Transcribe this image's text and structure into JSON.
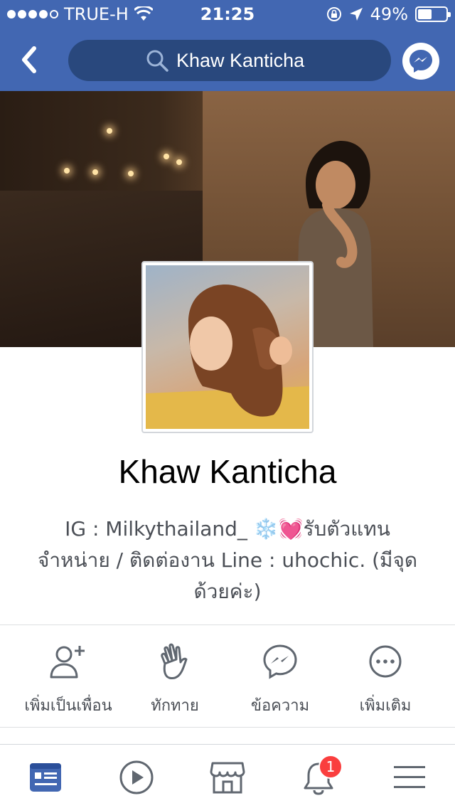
{
  "status_bar": {
    "carrier": "TRUE-H",
    "time": "21:25",
    "battery": "49%",
    "battery_level": 0.49
  },
  "nav": {
    "search_query": "Khaw Kanticha"
  },
  "profile": {
    "name": "Khaw Kanticha",
    "bio_line1": "IG : Milkythailand_ ❄️💓รับตัวแทน",
    "bio_line2": "จำหน่าย / ติดต่องาน Line : uhochic. (มีจุด",
    "bio_line3": "ด้วยค่ะ)"
  },
  "actions": [
    {
      "label": "เพิ่มเป็นเพื่อน",
      "icon": "add-friend-icon"
    },
    {
      "label": "ทักทาย",
      "icon": "wave-icon"
    },
    {
      "label": "ข้อความ",
      "icon": "messenger-icon"
    },
    {
      "label": "เพิ่มเติม",
      "icon": "more-icon"
    }
  ],
  "tabbar": {
    "tabs": [
      "news-feed-icon",
      "watch-icon",
      "marketplace-icon",
      "notifications-icon",
      "menu-icon"
    ],
    "notifications_badge": "1"
  },
  "colors": {
    "brand": "#4267b2",
    "search_bg": "#29487d",
    "badge": "#fa3e3e",
    "active_tab": "#4267b2"
  }
}
